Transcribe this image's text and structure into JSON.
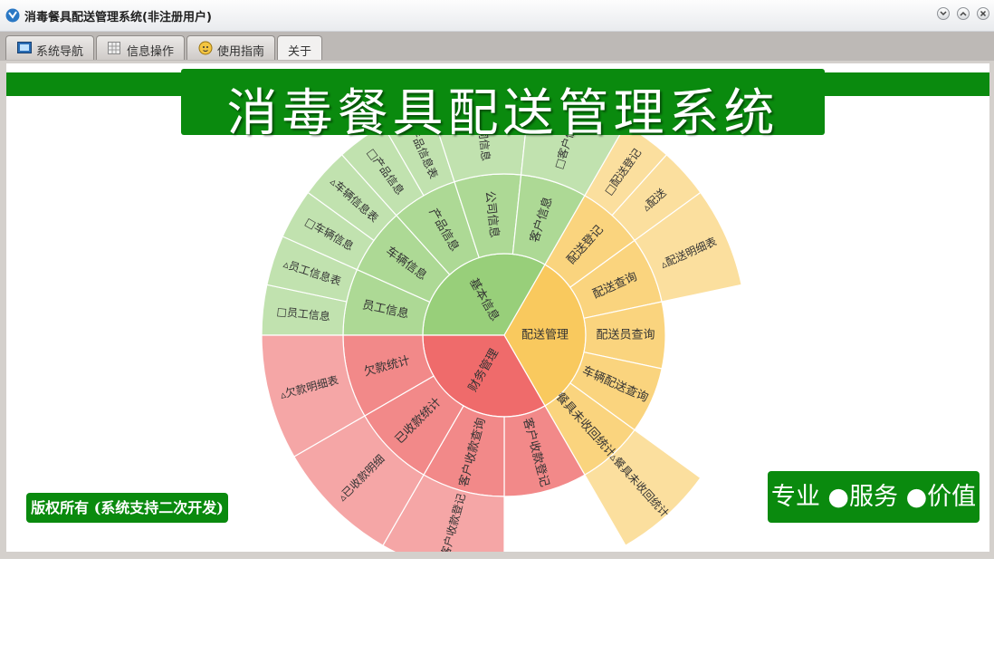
{
  "window": {
    "title": "消毒餐具配送管理系统(非注册用户)",
    "app_icon": "app-logo-icon"
  },
  "tabs": [
    {
      "label": "系统导航",
      "icon": "monitor-icon"
    },
    {
      "label": "信息操作",
      "icon": "grid-icon"
    },
    {
      "label": "使用指南",
      "icon": "help-face-icon"
    },
    {
      "label": "关于",
      "selected": true
    }
  ],
  "about": {
    "banner": "消毒餐具配送管理系统",
    "copyright": "版权所有 (系统支持二次开发)",
    "slogan": "专业 ●服务 ●价值"
  },
  "chart_data": {
    "type": "sunburst",
    "colors": {
      "基本信息": "#98cf7a",
      "财务管理": "#ef6b6b",
      "配送管理": "#f9c95e"
    },
    "nodes": [
      {
        "name": "基本信息",
        "children": [
          {
            "name": "员工信息",
            "children": [
              {
                "name": "□员工信息"
              },
              {
                "name": "▵员工信息表"
              }
            ]
          },
          {
            "name": "车辆信息",
            "children": [
              {
                "name": "□车辆信息"
              },
              {
                "name": "▵车辆信息表"
              }
            ]
          },
          {
            "name": "产品信息",
            "children": [
              {
                "name": "□产品信息"
              },
              {
                "name": "▵产品信息表"
              }
            ]
          },
          {
            "name": "公司信息",
            "children": [
              {
                "name": "□公司信息"
              }
            ]
          },
          {
            "name": "客户信息",
            "children": [
              {
                "name": "□客户信息"
              }
            ]
          }
        ]
      },
      {
        "name": "配送管理",
        "children": [
          {
            "name": "配送登记",
            "children": [
              {
                "name": "□配送登记"
              },
              {
                "name": "▵配送"
              }
            ]
          },
          {
            "name": "配送查询",
            "children": [
              {
                "name": "▵配送明细表"
              }
            ]
          },
          {
            "name": "配送员查询",
            "children": []
          },
          {
            "name": "车辆配送查询",
            "children": []
          },
          {
            "name": "餐具未收回统计",
            "children": [
              {
                "name": "▵餐具未收回统计"
              }
            ]
          }
        ]
      },
      {
        "name": "财务管理",
        "children": [
          {
            "name": "客户收款登记",
            "children": []
          },
          {
            "name": "客户收款查询",
            "children": [
              {
                "name": "□客户收款登记"
              }
            ]
          },
          {
            "name": "已收款统计",
            "children": [
              {
                "name": "▵已收款明细"
              }
            ]
          },
          {
            "name": "欠款统计",
            "children": [
              {
                "name": "▵欠款明细表"
              }
            ]
          }
        ]
      }
    ]
  }
}
